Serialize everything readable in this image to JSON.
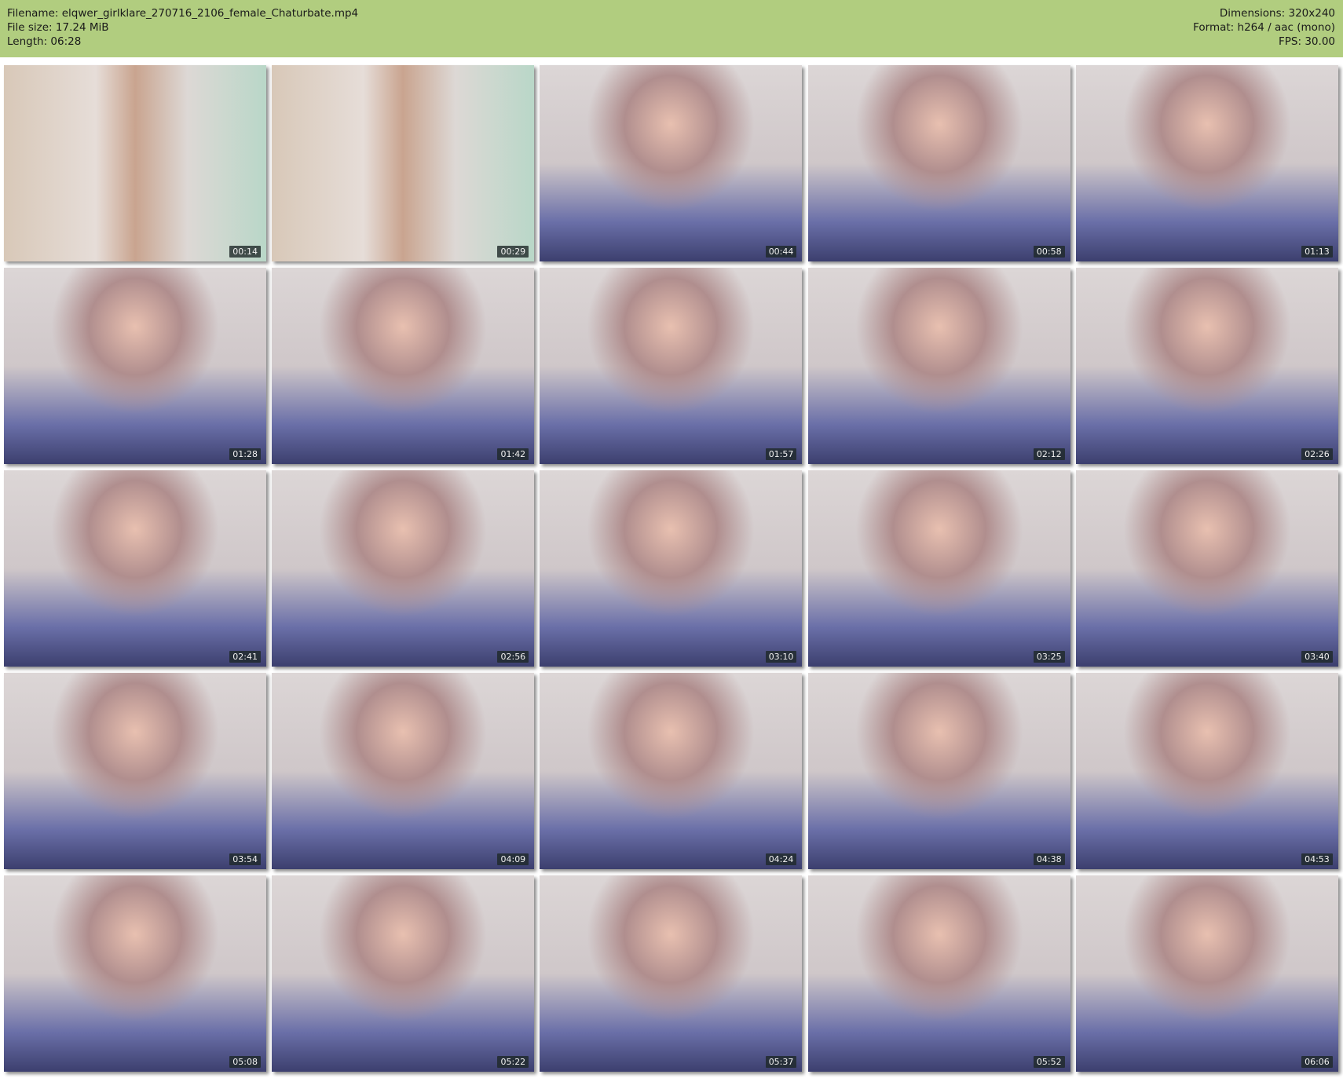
{
  "header": {
    "filename": "Filename: elqwer_girlklare_270716_2106_female_Chaturbate.mp4",
    "file_size": "File size: 17.24 MiB",
    "length": "Length: 06:28",
    "dimensions": "Dimensions: 320x240",
    "format": "Format: h264 / aac (mono)",
    "fps": "FPS: 30.00"
  },
  "thumbnails": [
    {
      "time": "00:14"
    },
    {
      "time": "00:29"
    },
    {
      "time": "00:44"
    },
    {
      "time": "00:58"
    },
    {
      "time": "01:13"
    },
    {
      "time": "01:28"
    },
    {
      "time": "01:42"
    },
    {
      "time": "01:57"
    },
    {
      "time": "02:12"
    },
    {
      "time": "02:26"
    },
    {
      "time": "02:41"
    },
    {
      "time": "02:56"
    },
    {
      "time": "03:10"
    },
    {
      "time": "03:25"
    },
    {
      "time": "03:40"
    },
    {
      "time": "03:54"
    },
    {
      "time": "04:09"
    },
    {
      "time": "04:24"
    },
    {
      "time": "04:38"
    },
    {
      "time": "04:53"
    },
    {
      "time": "05:08"
    },
    {
      "time": "05:22"
    },
    {
      "time": "05:37"
    },
    {
      "time": "05:52"
    },
    {
      "time": "06:06"
    }
  ]
}
